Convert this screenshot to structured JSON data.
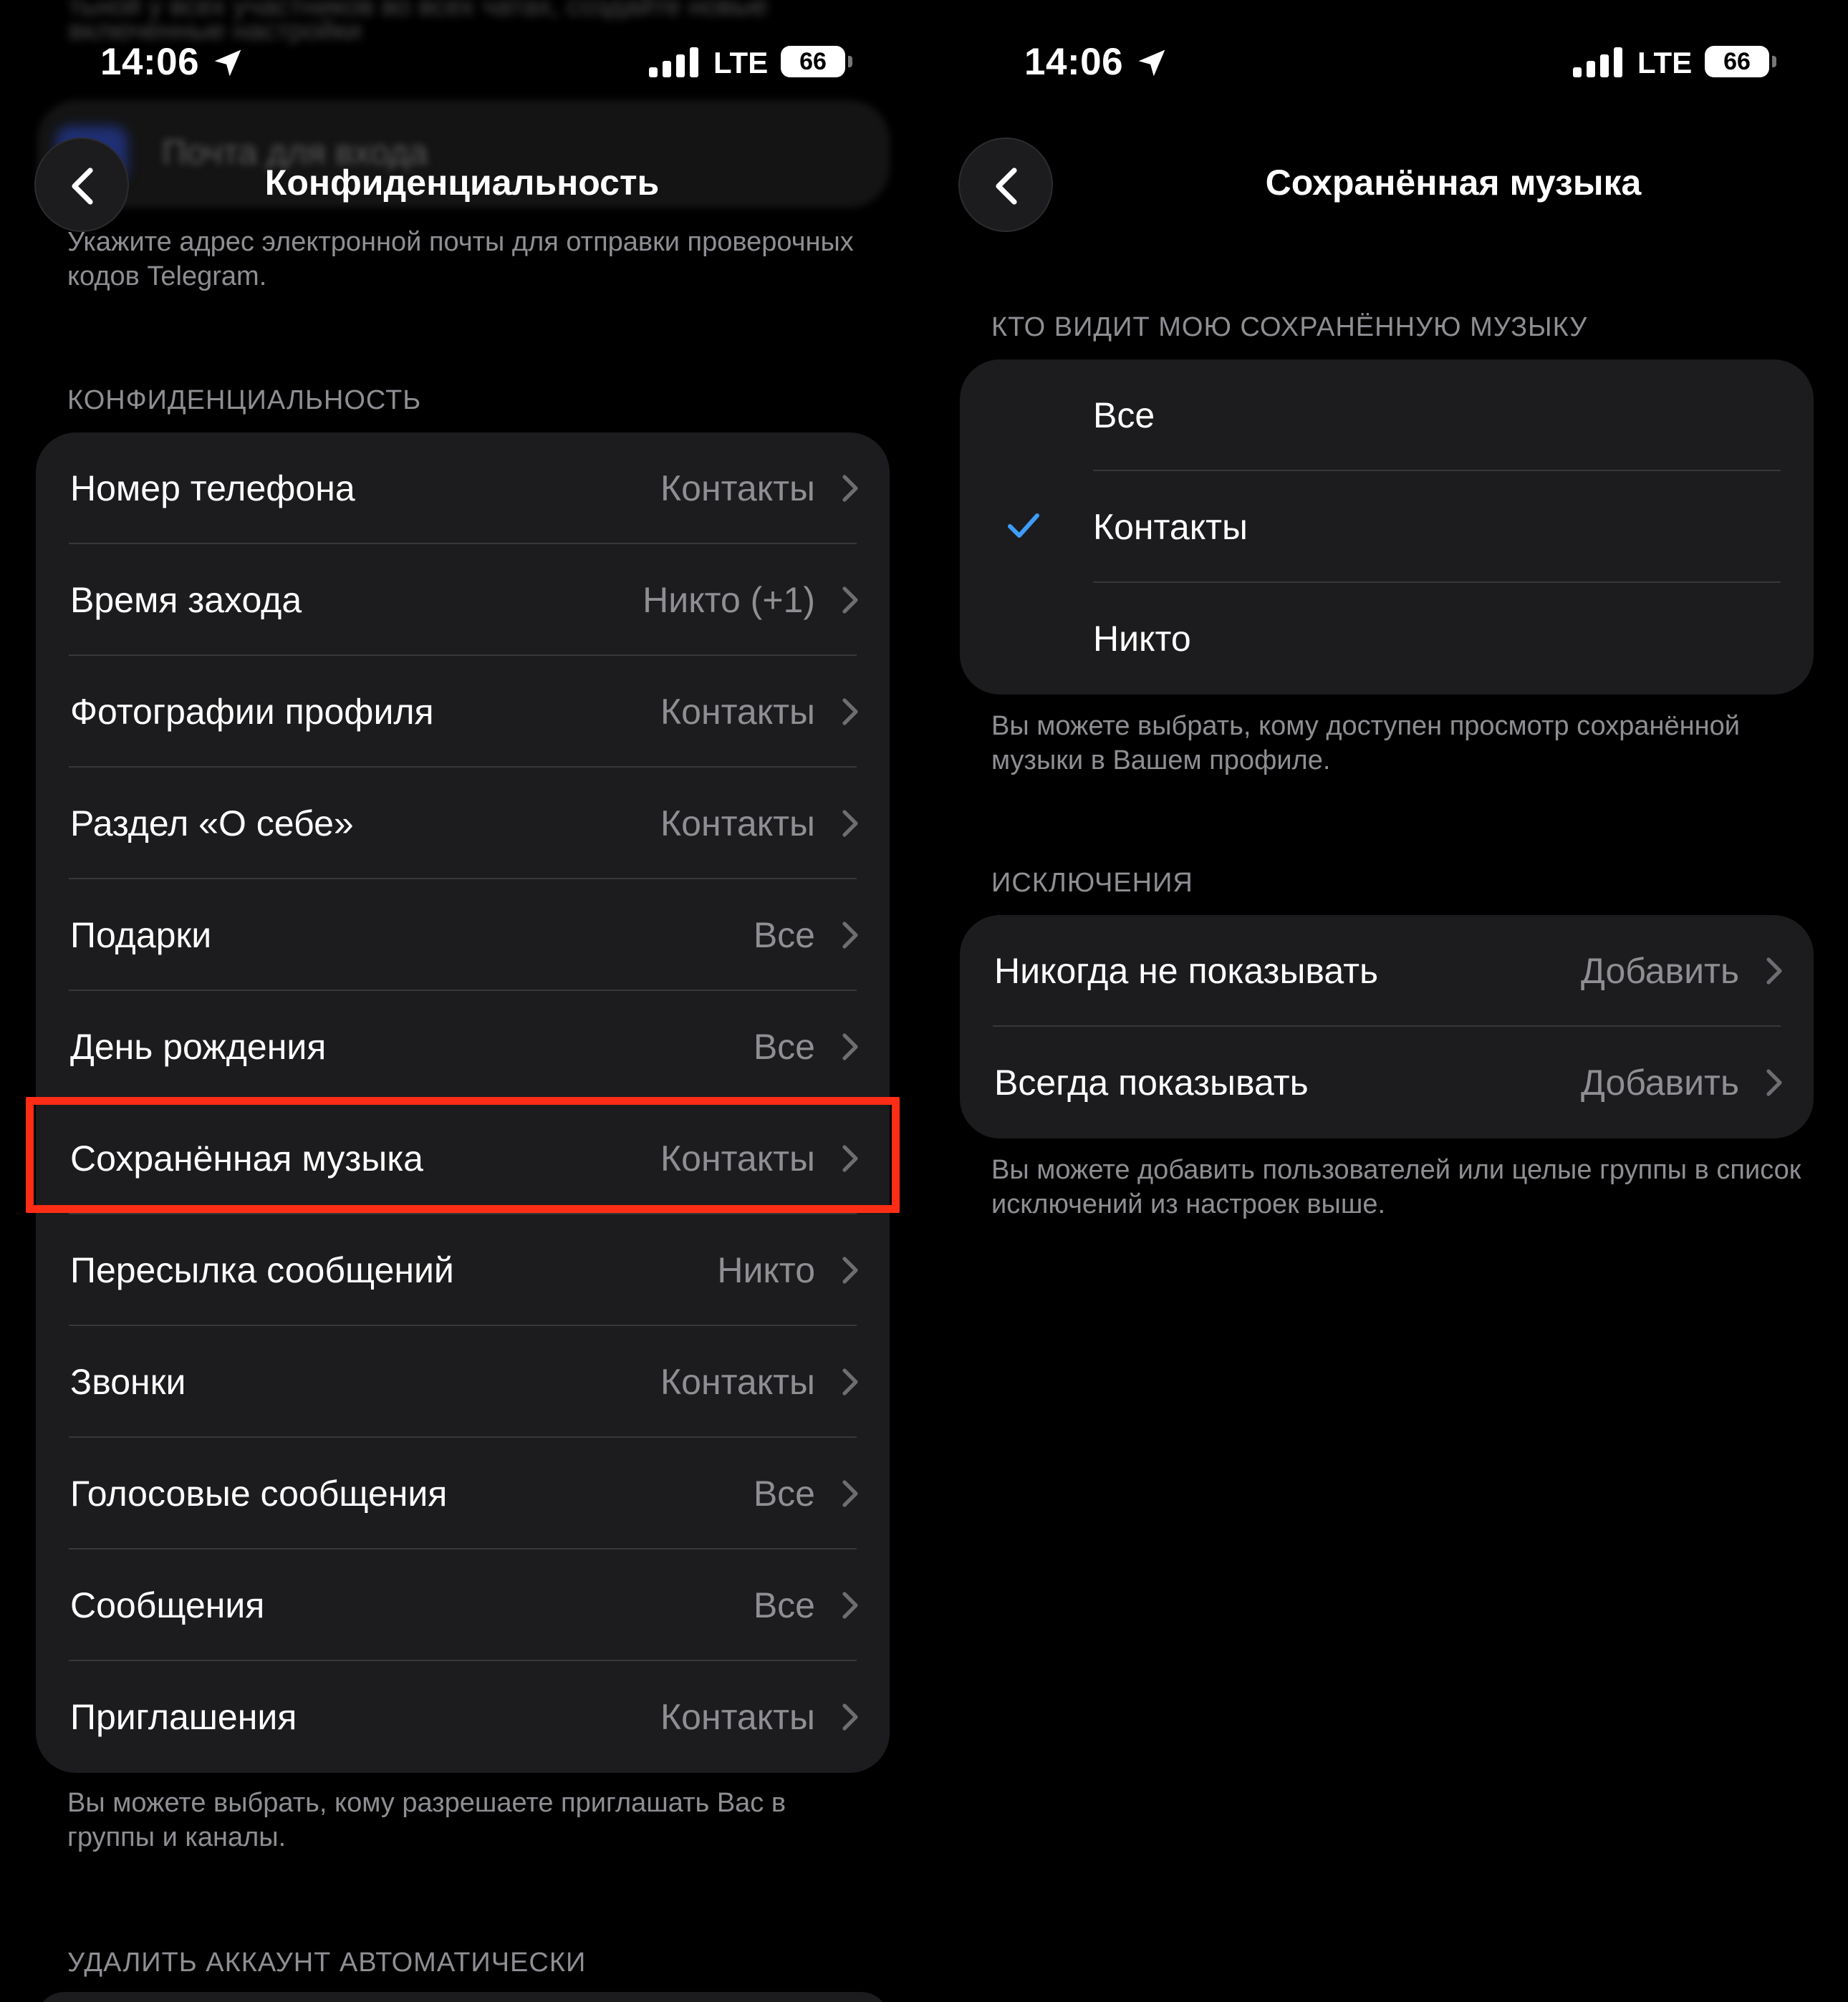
{
  "status_bar": {
    "time": "14:06",
    "network": "LTE",
    "battery": "66"
  },
  "left": {
    "ghost_top_text": "тьной у всех участников во всех чатах, создайте новые",
    "ghost_top_text2": "включенные настройки",
    "ghost_row_label": "Почта для входа",
    "title": "Конфиденциальность",
    "email_note": "Укажите адрес электронной почты для отправки проверочных кодов Telegram.",
    "section_header": "КОНФИДЕНЦИАЛЬНОСТЬ",
    "rows": [
      {
        "label": "Номер телефона",
        "value": "Контакты"
      },
      {
        "label": "Время захода",
        "value": "Никто (+1)"
      },
      {
        "label": "Фотографии профиля",
        "value": "Контакты"
      },
      {
        "label": "Раздел «О себе»",
        "value": "Контакты"
      },
      {
        "label": "Подарки",
        "value": "Все"
      },
      {
        "label": "День рождения",
        "value": "Все"
      },
      {
        "label": "Сохранённая музыка",
        "value": "Контакты"
      },
      {
        "label": "Пересылка сообщений",
        "value": "Никто"
      },
      {
        "label": "Звонки",
        "value": "Контакты"
      },
      {
        "label": "Голосовые сообщения",
        "value": "Все"
      },
      {
        "label": "Сообщения",
        "value": "Все"
      },
      {
        "label": "Приглашения",
        "value": "Контакты"
      }
    ],
    "footer_note": "Вы можете выбрать, кому разрешаете приглашать Вас в группы и каналы.",
    "delete_header": "УДАЛИТЬ АККАУНТ АВТОМАТИЧЕСКИ",
    "highlight_color": "#ff2c16"
  },
  "right": {
    "title": "Сохранённая музыка",
    "section_header": "КТО ВИДИТ МОЮ СОХРАНЁННУЮ МУЗЫКУ",
    "options": [
      {
        "label": "Все",
        "selected": false
      },
      {
        "label": "Контакты",
        "selected": true
      },
      {
        "label": "Никто",
        "selected": false
      }
    ],
    "options_note": "Вы можете выбрать, кому доступен просмотр сохранённой музыки в Вашем профиле.",
    "exceptions_header": "ИСКЛЮЧЕНИЯ",
    "exceptions": [
      {
        "label": "Никогда не показывать",
        "value": "Добавить"
      },
      {
        "label": "Всегда показывать",
        "value": "Добавить"
      }
    ],
    "exceptions_note": "Вы можете добавить пользователей или целые группы в список исключений из настроек выше.",
    "check_color": "#3e9dfb"
  }
}
